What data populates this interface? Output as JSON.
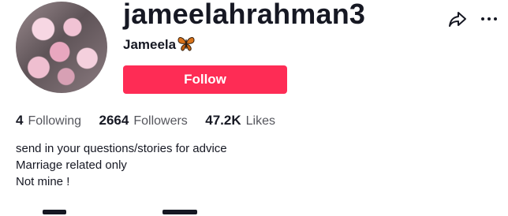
{
  "profile": {
    "username": "jameelahrahman3",
    "display_name": "Jameela",
    "display_name_emoji": "butterfly-icon"
  },
  "actions": {
    "follow_label": "Follow",
    "share_icon": "share-icon",
    "more_icon": "more-icon"
  },
  "stats": [
    {
      "value": "4",
      "label": "Following"
    },
    {
      "value": "2664",
      "label": "Followers"
    },
    {
      "value": "47.2K",
      "label": "Likes"
    }
  ],
  "bio": [
    "send in your questions/stories for advice",
    "Marriage related only",
    "Not mine !"
  ],
  "colors": {
    "follow_button": "#fe2c55",
    "text_primary": "#161823",
    "text_secondary": "#55565d"
  }
}
